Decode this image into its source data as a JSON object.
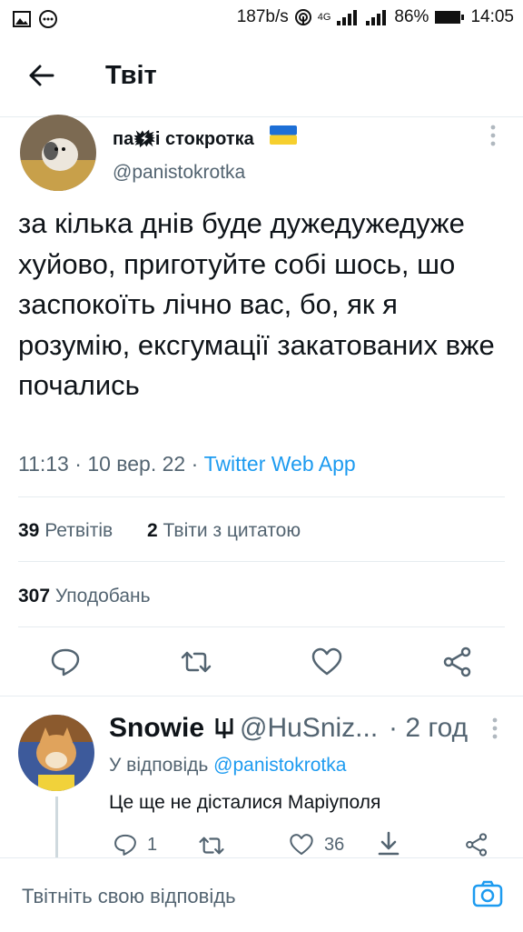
{
  "status_bar": {
    "network_speed": "187b/s",
    "network_type": "4G",
    "battery": "86%",
    "time": "14:05"
  },
  "header": {
    "title": "Твіт"
  },
  "tweet": {
    "author_name": "па🗱і стокротка",
    "handle": "@panistokrotka",
    "text": "за кілька днів буде дужедужедуже хуйово, приготуйте собі шось, шо заспокоїть лічно вас, бо, як я розумію, ексгумації закатованих вже почались",
    "time": "11:13",
    "date": "10 вер. 22",
    "source": "Twitter Web App",
    "retweets_count": "39",
    "retweets_label": "Ретвітів",
    "quotes_count": "2",
    "quotes_label": "Твіти з цитатою",
    "likes_count": "307",
    "likes_label": "Уподобань"
  },
  "reply": {
    "author_name": "Snowie",
    "handle": "@HuSniz...",
    "time_ago": "2 год",
    "reply_to_prefix": "У відповідь",
    "reply_to_handle": "@panistokrotka",
    "text": "Це ще не дісталися Маріуполя",
    "reply_count": "1",
    "like_count": "36"
  },
  "compose": {
    "placeholder": "Твітніть свою відповідь"
  },
  "colors": {
    "accent": "#1d9bf0",
    "secondary_text": "#536471",
    "divider": "#e6ecf0"
  }
}
